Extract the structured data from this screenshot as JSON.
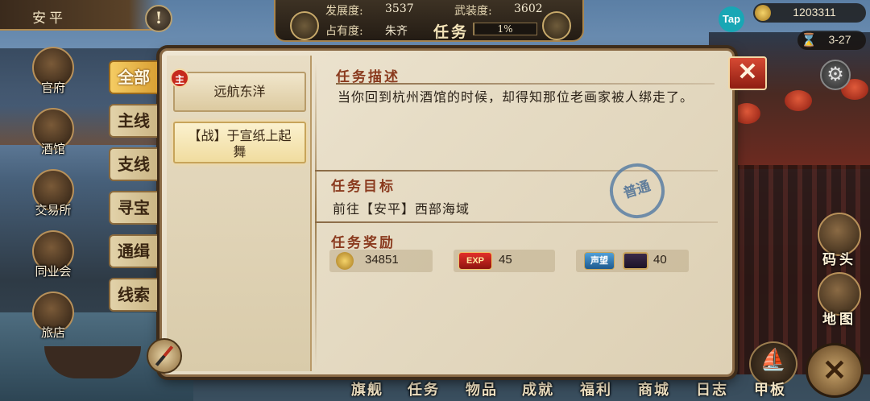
{
  "city": {
    "name": "安平"
  },
  "hud": {
    "development_label": "发展度:",
    "development_value": "3537",
    "armament_label": "武装度:",
    "armament_value": "3602",
    "occupancy_label": "占有度:",
    "occupancy_value": "朱齐",
    "title": "任务",
    "progress_label": "1%",
    "progress_fraction": 0.01
  },
  "top_right": {
    "tap_label": "Tap",
    "gold": "1203311",
    "date": "3-27"
  },
  "buildings": [
    {
      "label": "官府"
    },
    {
      "label": "酒馆"
    },
    {
      "label": "交易所"
    },
    {
      "label": "同业会"
    },
    {
      "label": "旅店"
    }
  ],
  "categories": [
    {
      "label": "全部",
      "active": true
    },
    {
      "label": "主线",
      "active": false
    },
    {
      "label": "支线",
      "active": false
    },
    {
      "label": "寻宝",
      "active": false
    },
    {
      "label": "通缉",
      "active": false
    },
    {
      "label": "线索",
      "active": false
    }
  ],
  "quests": [
    {
      "badge": "主",
      "title": "远航东洋",
      "selected": false
    },
    {
      "badge": "",
      "title": "【战】于宣纸上起舞",
      "selected": true
    }
  ],
  "detail": {
    "desc_title": "任务描述",
    "desc_text": "当你回到杭州酒馆的时候，却得知那位老画家被人绑走了。",
    "goal_title": "任务目标",
    "goal_text": "前往【安平】西部海域",
    "reward_title": "任务奖励",
    "stamp": "普通",
    "rewards": {
      "coins": "34851",
      "exp_label": "EXP",
      "exp": "45",
      "fame_label": "声望",
      "fame": "40"
    }
  },
  "side_buttons": {
    "dock": "码头",
    "map": "地图"
  },
  "bottom_nav": [
    "旗舰",
    "任务",
    "物品",
    "成就",
    "福利",
    "商城",
    "日志",
    "甲板"
  ]
}
